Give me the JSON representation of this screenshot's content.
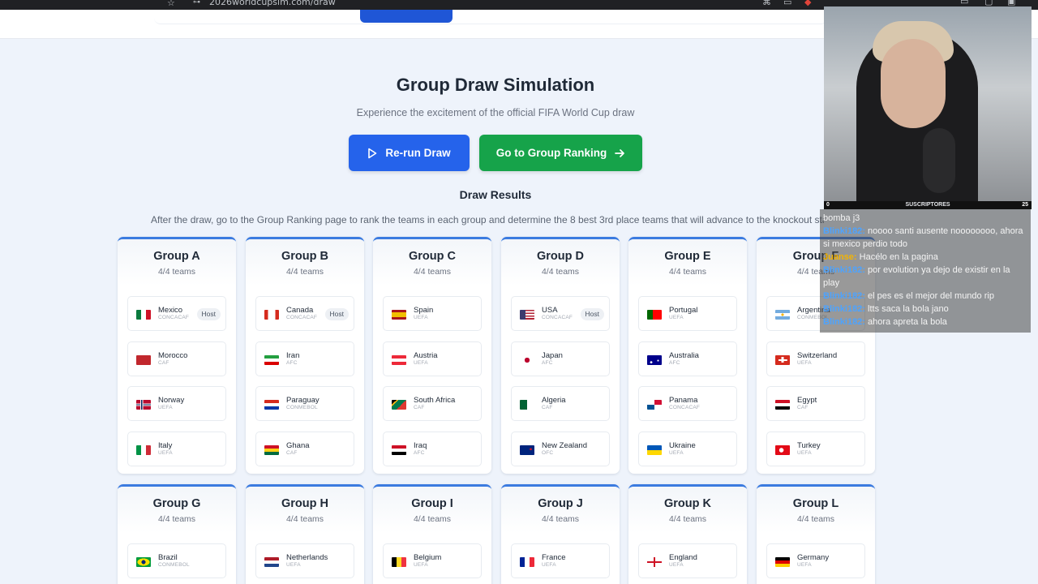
{
  "browser": {
    "url": "2026worldcupsim.com/draw"
  },
  "page": {
    "title": "Group Draw Simulation",
    "subtitle": "Experience the excitement of the official FIFA World Cup draw",
    "rerun_label": "Re-run Draw",
    "ranking_label": "Go to Group Ranking",
    "results_title": "Draw Results",
    "results_desc": "After the draw, go to the Group Ranking page to rank the teams in each group and determine the 8 best 3rd place teams that will advance to the knockout stage."
  },
  "groups": [
    {
      "name": "Group A",
      "count": "4/4 teams",
      "teams": [
        {
          "name": "Mexico",
          "conf": "CONCACAF",
          "flag": "mexico",
          "host": "Host"
        },
        {
          "name": "Morocco",
          "conf": "CAF",
          "flag": "morocco"
        },
        {
          "name": "Norway",
          "conf": "UEFA",
          "flag": "norway"
        },
        {
          "name": "Italy",
          "conf": "UEFA",
          "flag": "italy"
        }
      ]
    },
    {
      "name": "Group B",
      "count": "4/4 teams",
      "teams": [
        {
          "name": "Canada",
          "conf": "CONCACAF",
          "flag": "canada",
          "host": "Host"
        },
        {
          "name": "Iran",
          "conf": "AFC",
          "flag": "iran"
        },
        {
          "name": "Paraguay",
          "conf": "CONMEBOL",
          "flag": "paraguay"
        },
        {
          "name": "Ghana",
          "conf": "CAF",
          "flag": "ghana"
        }
      ]
    },
    {
      "name": "Group C",
      "count": "4/4 teams",
      "teams": [
        {
          "name": "Spain",
          "conf": "UEFA",
          "flag": "spain"
        },
        {
          "name": "Austria",
          "conf": "UEFA",
          "flag": "austria"
        },
        {
          "name": "South Africa",
          "conf": "CAF",
          "flag": "southafrica"
        },
        {
          "name": "Iraq",
          "conf": "AFC",
          "flag": "iraq"
        }
      ]
    },
    {
      "name": "Group D",
      "count": "4/4 teams",
      "teams": [
        {
          "name": "USA",
          "conf": "CONCACAF",
          "flag": "usa",
          "host": "Host"
        },
        {
          "name": "Japan",
          "conf": "AFC",
          "flag": "japan"
        },
        {
          "name": "Algeria",
          "conf": "CAF",
          "flag": "algeria"
        },
        {
          "name": "New Zealand",
          "conf": "OFC",
          "flag": "newzealand"
        }
      ]
    },
    {
      "name": "Group E",
      "count": "4/4 teams",
      "teams": [
        {
          "name": "Portugal",
          "conf": "UEFA",
          "flag": "portugal"
        },
        {
          "name": "Australia",
          "conf": "AFC",
          "flag": "australia"
        },
        {
          "name": "Panama",
          "conf": "CONCACAF",
          "flag": "panama"
        },
        {
          "name": "Ukraine",
          "conf": "UEFA",
          "flag": "ukraine"
        }
      ]
    },
    {
      "name": "Group F",
      "count": "4/4 teams",
      "teams": [
        {
          "name": "Argentina",
          "conf": "CONMEBOL",
          "flag": "argentina"
        },
        {
          "name": "Switzerland",
          "conf": "UEFA",
          "flag": "switzerland"
        },
        {
          "name": "Egypt",
          "conf": "CAF",
          "flag": "egypt"
        },
        {
          "name": "Turkey",
          "conf": "UEFA",
          "flag": "turkey"
        }
      ]
    },
    {
      "name": "Group G",
      "count": "4/4 teams",
      "teams": [
        {
          "name": "Brazil",
          "conf": "CONMEBOL",
          "flag": "brazil"
        }
      ]
    },
    {
      "name": "Group H",
      "count": "4/4 teams",
      "teams": [
        {
          "name": "Netherlands",
          "conf": "UEFA",
          "flag": "netherlands"
        }
      ]
    },
    {
      "name": "Group I",
      "count": "4/4 teams",
      "teams": [
        {
          "name": "Belgium",
          "conf": "UEFA",
          "flag": "belgium"
        }
      ]
    },
    {
      "name": "Group J",
      "count": "4/4 teams",
      "teams": [
        {
          "name": "France",
          "conf": "UEFA",
          "flag": "france"
        }
      ]
    },
    {
      "name": "Group K",
      "count": "4/4 teams",
      "teams": [
        {
          "name": "England",
          "conf": "UEFA",
          "flag": "england"
        }
      ]
    },
    {
      "name": "Group L",
      "count": "4/4 teams",
      "teams": [
        {
          "name": "Germany",
          "conf": "UEFA",
          "flag": "germany"
        }
      ]
    }
  ],
  "stream": {
    "cam_label": "SUSCRIPTORES",
    "cam_left": "0",
    "cam_right": "25",
    "chat": [
      {
        "user": "",
        "text": "bomba j3"
      },
      {
        "user": "Blinki182",
        "text": "noooo santi ausente noooooooo, ahora si mexico perdio todo"
      },
      {
        "user": "Juanse",
        "gold": true,
        "text": "Hacélo en la pagina"
      },
      {
        "user": "Blinki182",
        "text": "por evolution ya dejo de existir en la play"
      },
      {
        "user": "Blinki182",
        "text": "el pes es el mejor del mundo rip"
      },
      {
        "user": "Blinki182",
        "text": "ltts saca la bola jano"
      },
      {
        "user": "Blinki182",
        "text": "ahora apreta la bola"
      }
    ]
  }
}
